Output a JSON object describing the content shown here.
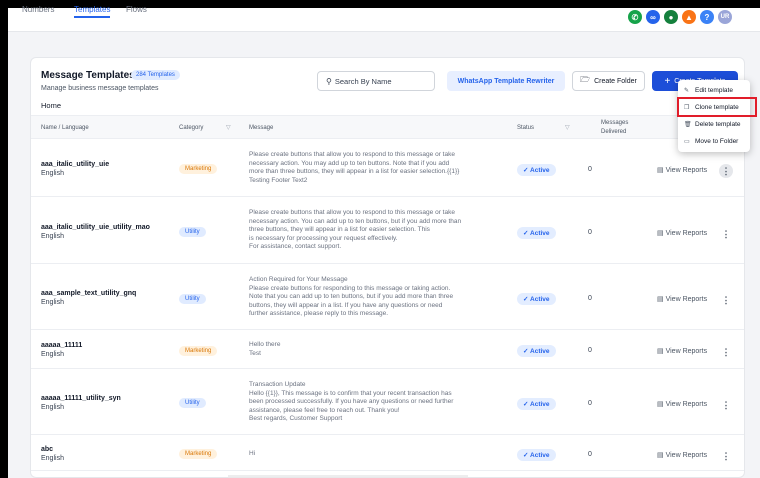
{
  "nav": {
    "tabs": [
      "Numbers",
      "Templates",
      "Flows"
    ],
    "active_index": 1
  },
  "header_icons": [
    {
      "name": "phone-icon",
      "color": "#16a34a"
    },
    {
      "name": "link-icon",
      "color": "#2563eb"
    },
    {
      "name": "chat-icon",
      "color": "#15803d"
    },
    {
      "name": "bell-icon",
      "color": "#f97316"
    },
    {
      "name": "help-icon",
      "color": "#3b82f6"
    },
    {
      "name": "avatar",
      "color": "#9aa5d8",
      "text": "UR"
    }
  ],
  "page": {
    "title": "Message Templates",
    "count_badge": "284 Templates",
    "subtitle": "Manage business message templates",
    "breadcrumb": "Home"
  },
  "toolbar": {
    "search_placeholder": "Search By Name",
    "rewriter_label": "WhatsApp Template Rewriter",
    "create_folder_label": "Create Folder",
    "create_template_label": "Create Template"
  },
  "table": {
    "headers": {
      "name": "Name / Language",
      "category": "Category",
      "message": "Message",
      "status": "Status",
      "delivered_1": "Messages",
      "delivered_2": "Delivered"
    },
    "rows": [
      {
        "name": "aaa_italic_utility_uie",
        "lang": "English",
        "category": "Marketing",
        "message": [
          "Please create buttons that allow you to respond to this message or take",
          "necessary action. You may add up to ten buttons. Note that if you add",
          "more than three buttons, they will appear in a list for easier selection.{{1}}",
          "Testing Footer Text2"
        ],
        "status": "Active",
        "delivered": "0",
        "action": "View Reports"
      },
      {
        "name": "aaa_italic_utility_uie_utility_mao",
        "lang": "English",
        "category": "Utility",
        "message": [
          "Please create buttons that allow you to respond to this message or take",
          "necessary action. You can add up to ten buttons, but if you add more than",
          "three buttons, they will appear in a list for easier selection. This",
          "is necessary for processing your request effectively.",
          "For assistance, contact support."
        ],
        "status": "Active",
        "delivered": "0",
        "action": "View Reports"
      },
      {
        "name": "aaa_sample_text_utility_gnq",
        "lang": "English",
        "category": "Utility",
        "message": [
          "Action Required for Your Message",
          "Please create buttons for responding to this message or taking action.",
          "Note that you can add up to ten buttons, but if you add more than three",
          "buttons, they will appear in a list. If you have any questions or need",
          "further assistance, please reply to this message."
        ],
        "status": "Active",
        "delivered": "0",
        "action": "View Reports"
      },
      {
        "name": "aaaaa_11111",
        "lang": "English",
        "category": "Marketing",
        "message": [
          "Hello there",
          "Test"
        ],
        "status": "Active",
        "delivered": "0",
        "action": "View Reports"
      },
      {
        "name": "aaaaa_11111_utility_syn",
        "lang": "English",
        "category": "Utility",
        "message": [
          "Transaction Update",
          "Hello {{1}}, This message is to confirm that your recent transaction has",
          "been processed successfully. If you have any questions or need further",
          "assistance, please feel free to reach out. Thank you!",
          "Best regards, Customer Support"
        ],
        "status": "Active",
        "delivered": "0",
        "action": "View Reports"
      },
      {
        "name": "abc",
        "lang": "English",
        "category": "Marketing",
        "message": [
          "Hi"
        ],
        "status": "Active",
        "delivered": "0",
        "action": "View Reports"
      }
    ]
  },
  "context_menu": {
    "items": [
      "Edit template",
      "Clone template",
      "Delete template",
      "Move to Folder"
    ],
    "highlighted_index": 1
  }
}
